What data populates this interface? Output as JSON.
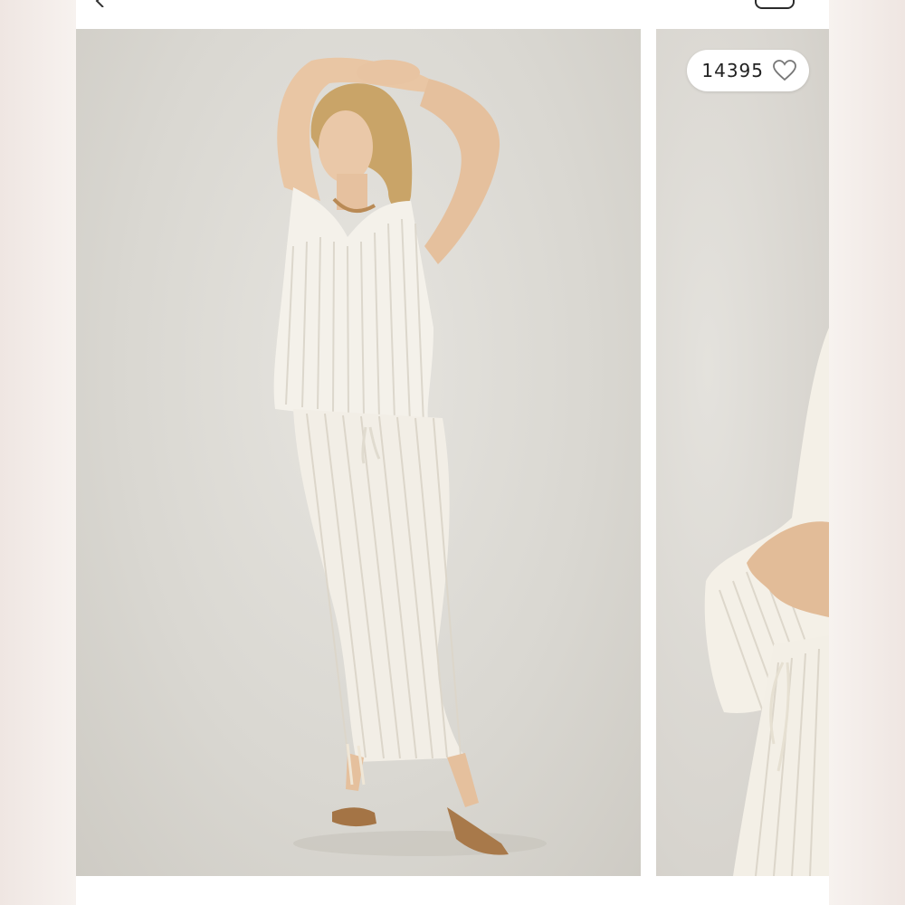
{
  "listing": {
    "like_count": "14395",
    "photos": [
      {
        "description": "main-photo"
      },
      {
        "description": "next-photo"
      }
    ]
  },
  "icons": {
    "back": "chevron-left-icon",
    "like": "heart-outline-icon"
  },
  "colors": {
    "page_background": "#f3ede9",
    "card_background": "#ffffff",
    "photo_background": "#dcd9d3",
    "garment": "#f4f1ea",
    "text": "#222222"
  }
}
